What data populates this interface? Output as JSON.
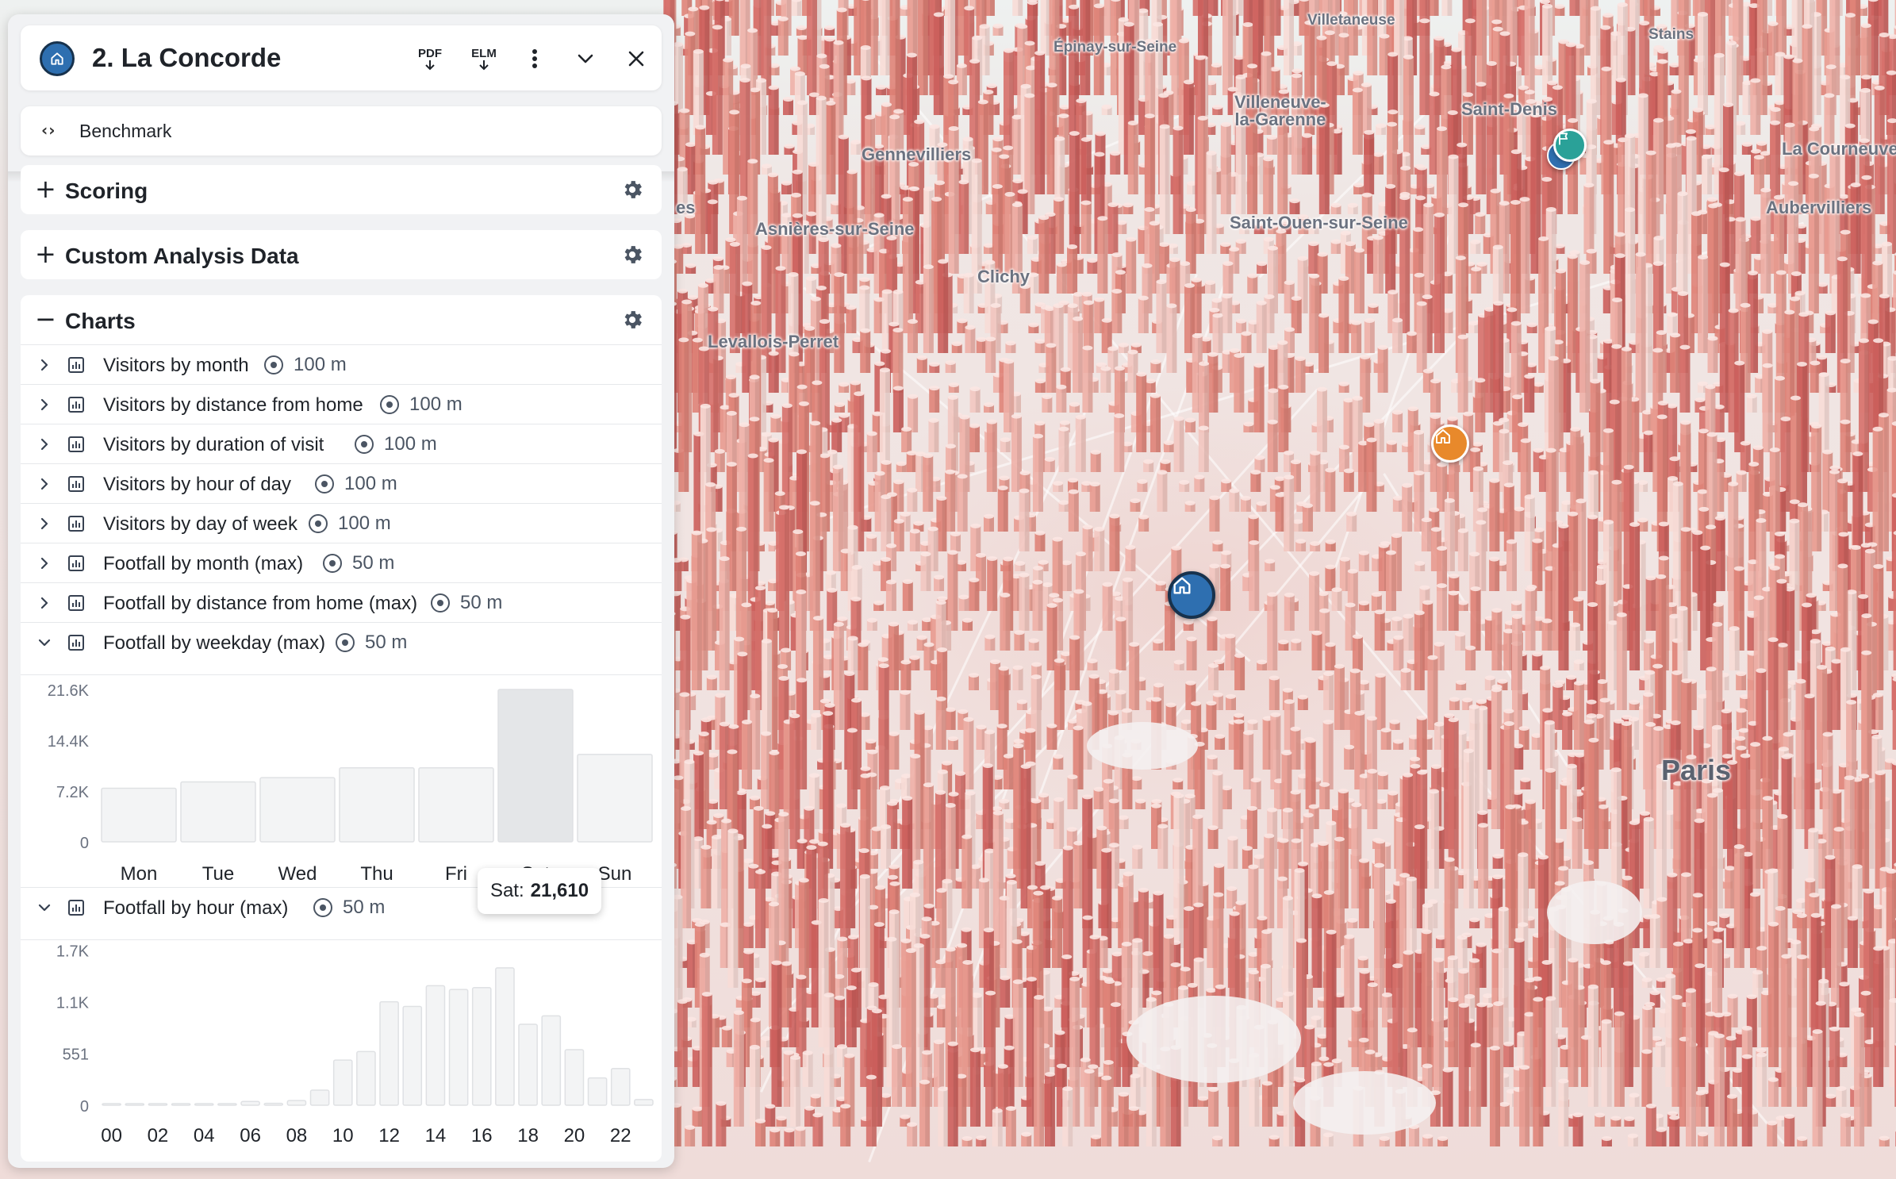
{
  "panel": {
    "title": "2. La Concorde",
    "header_buttons": {
      "pdf": "PDF",
      "elm": "ELM"
    },
    "benchmark_label": "Benchmark",
    "sections": [
      {
        "sign": "+",
        "label": "Scoring"
      },
      {
        "sign": "+",
        "label": "Custom Analysis Data"
      },
      {
        "sign": "−",
        "label": "Charts"
      }
    ],
    "chart_rows": [
      {
        "label": "Visitors by month",
        "radius": "100 m",
        "expanded": false
      },
      {
        "label": "Visitors by distance from home",
        "radius": "100 m",
        "expanded": false
      },
      {
        "label": "Visitors by duration of visit",
        "radius": "100 m",
        "expanded": false
      },
      {
        "label": "Visitors by hour of day",
        "radius": "100 m",
        "expanded": false
      },
      {
        "label": "Visitors by day of week",
        "radius": "100 m",
        "expanded": false
      },
      {
        "label": "Footfall by month (max)",
        "radius": "50 m",
        "expanded": false
      },
      {
        "label": "Footfall by distance from home (max)",
        "radius": "50 m",
        "expanded": false
      },
      {
        "label": "Footfall by weekday (max)",
        "radius": "50 m",
        "expanded": true
      },
      {
        "label": "Footfall by hour (max)",
        "radius": "50 m",
        "expanded": true
      }
    ],
    "tooltip": {
      "label": "Sat:",
      "value": "21,610"
    }
  },
  "colors": {
    "accent": "#2e6fb0",
    "bar": "#f3f4f5",
    "bar_stroke": "#dfe1e4",
    "bar_highlight": "#e4e6e8",
    "pin_orange": "#e8892b",
    "pin_teal": "#2aa198"
  },
  "chart_data": [
    {
      "type": "bar",
      "title": "Footfall by weekday (max)",
      "categories": [
        "Mon",
        "Tue",
        "Wed",
        "Thu",
        "Fri",
        "Sat",
        "Sun"
      ],
      "values": [
        7600,
        8500,
        9100,
        10500,
        10500,
        21610,
        12400
      ],
      "highlighted": "Sat",
      "ytick_labels": [
        "21.6K",
        "14.4K",
        "7.2K",
        "0"
      ],
      "yticks": [
        21600,
        14400,
        7200,
        0
      ],
      "ylim": [
        0,
        21610
      ]
    },
    {
      "type": "bar",
      "title": "Footfall by hour (max)",
      "categories": [
        "00",
        "01",
        "02",
        "03",
        "04",
        "05",
        "06",
        "07",
        "08",
        "09",
        "10",
        "11",
        "12",
        "13",
        "14",
        "15",
        "16",
        "17",
        "18",
        "19",
        "20",
        "21",
        "22",
        "23"
      ],
      "xtick_labels": [
        "00",
        "02",
        "04",
        "06",
        "08",
        "10",
        "12",
        "14",
        "16",
        "18",
        "20",
        "22"
      ],
      "values": [
        10,
        5,
        8,
        5,
        14,
        5,
        40,
        20,
        50,
        160,
        480,
        570,
        1100,
        1050,
        1270,
        1230,
        1250,
        1460,
        860,
        950,
        590,
        290,
        390,
        60
      ],
      "ytick_labels": [
        "1.7K",
        "1.1K",
        "551",
        "0"
      ],
      "yticks": [
        1650,
        1100,
        551,
        0
      ],
      "ylim": [
        0,
        1653
      ]
    }
  ],
  "map": {
    "labels": [
      {
        "text": "Villetaneuse",
        "size": "small"
      },
      {
        "text": "Épinay-sur-Seine",
        "size": "small"
      },
      {
        "text": "Stains",
        "size": "small"
      },
      {
        "text": "Villeneuve-\nla-Garenne",
        "size": "multi"
      },
      {
        "text": "Saint-Denis",
        "size": "normal"
      },
      {
        "text": "La Courneuve",
        "size": "normal"
      },
      {
        "text": "Gennevilliers",
        "size": "normal"
      },
      {
        "text": "Asnières-sur-Seine",
        "size": "normal"
      },
      {
        "text": "Saint-Ouen-sur-Seine",
        "size": "normal"
      },
      {
        "text": "Aubervilliers",
        "size": "normal"
      },
      {
        "text": "Clichy",
        "size": "normal"
      },
      {
        "text": "Levallois-Perret",
        "size": "normal"
      },
      {
        "text": "Paris",
        "size": "big"
      },
      {
        "text": "es",
        "size": "normal"
      }
    ],
    "pins": [
      {
        "name": "selected-location-pin",
        "icon": "home-icon",
        "color": "#2e6fb0"
      },
      {
        "name": "competitor-location-pin",
        "icon": "home-icon",
        "color": "#e8892b"
      },
      {
        "name": "flag-location-pin",
        "icon": "flag-icon",
        "color": "#2aa198"
      }
    ]
  }
}
